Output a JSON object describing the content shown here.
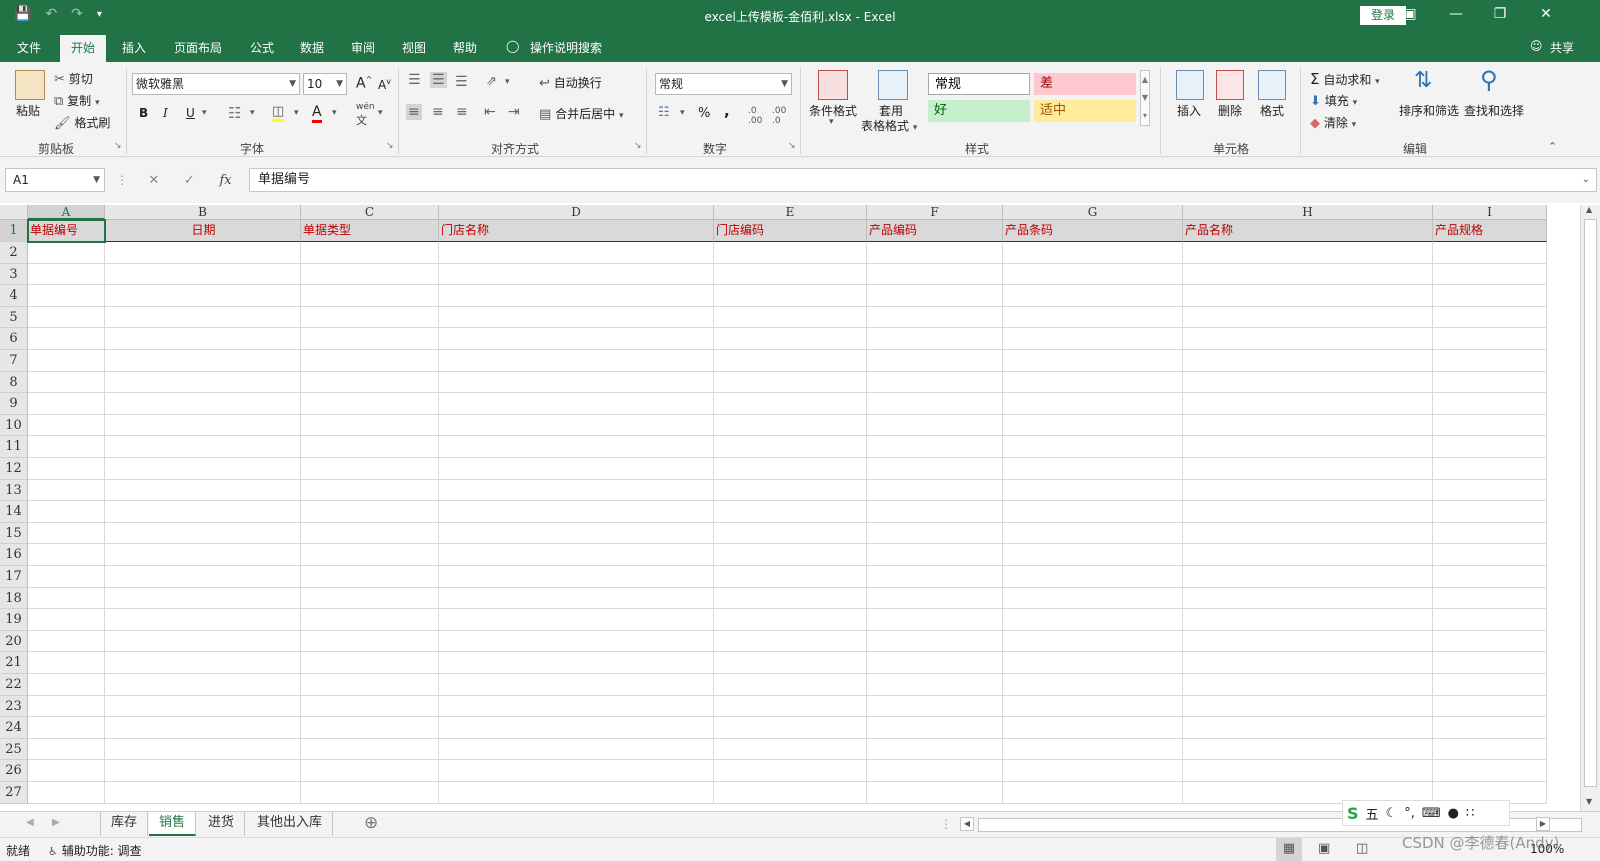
{
  "titlebar": {
    "title": "excel上传模板-金佰利.xlsx  -  Excel",
    "login": "登录"
  },
  "tabs": [
    "文件",
    "开始",
    "插入",
    "页面布局",
    "公式",
    "数据",
    "审阅",
    "视图",
    "帮助"
  ],
  "active_tab": "开始",
  "tell_me": "操作说明搜索",
  "share": "共享",
  "ribbon": {
    "clipboard": {
      "label": "剪贴板",
      "paste": "粘贴",
      "cut": "剪切",
      "copy": "复制",
      "format_painter": "格式刷"
    },
    "font": {
      "label": "字体",
      "font_name": "微软雅黑",
      "font_size": "10",
      "bold": "B",
      "italic": "I",
      "underline": "U",
      "grow": "A",
      "shrink": "A",
      "font_color": "A",
      "wen": "wén"
    },
    "alignment": {
      "label": "对齐方式",
      "wrap": "自动换行",
      "merge": "合并后居中"
    },
    "number": {
      "label": "数字",
      "format": "常规",
      "percent": "%",
      "comma": ","
    },
    "styles": {
      "label": "样式",
      "cond_format": "条件格式",
      "table_format_1": "套用",
      "table_format_2": "表格格式",
      "normal": "常规",
      "bad": "差",
      "good": "好",
      "neutral": "适中"
    },
    "cells": {
      "label": "单元格",
      "insert": "插入",
      "delete": "删除",
      "format": "格式"
    },
    "editing": {
      "label": "编辑",
      "autosum": "自动求和",
      "fill": "填充",
      "clear": "清除",
      "sort": "排序和筛选",
      "find": "查找和选择"
    }
  },
  "formula_bar": {
    "name_box": "A1",
    "fx": "fx",
    "formula": "单据编号"
  },
  "sheet": {
    "columns": [
      "A",
      "B",
      "C",
      "D",
      "E",
      "F",
      "G",
      "H",
      "I"
    ],
    "header_row": [
      "单据编号",
      "日期",
      "单据类型",
      "门店名称",
      "门店编码",
      "产品编码",
      "产品条码",
      "产品名称",
      "产品规格"
    ],
    "row_numbers": [
      "1",
      "2",
      "3",
      "4",
      "5",
      "6",
      "7",
      "8",
      "9",
      "10",
      "11",
      "12",
      "13",
      "14",
      "15",
      "16",
      "17",
      "18",
      "19",
      "20",
      "21",
      "22",
      "23",
      "24",
      "25",
      "26",
      "27"
    ],
    "active_cell": "A1"
  },
  "sheet_tabs": [
    "库存",
    "销售",
    "进货",
    "其他出入库"
  ],
  "active_sheet": "销售",
  "statusbar": {
    "ready": "就绪",
    "accessibility": "辅助功能: 调查",
    "zoom": "100%"
  },
  "ime_bar": {
    "mode": "五"
  },
  "watermark": "CSDN @李德春(Andy)",
  "colors": {
    "excel_green": "#217346",
    "header_text_red": "#c00000",
    "bad_fill": "#ffc7ce",
    "good_fill": "#c6efce",
    "neutral_fill": "#ffeb9c"
  }
}
